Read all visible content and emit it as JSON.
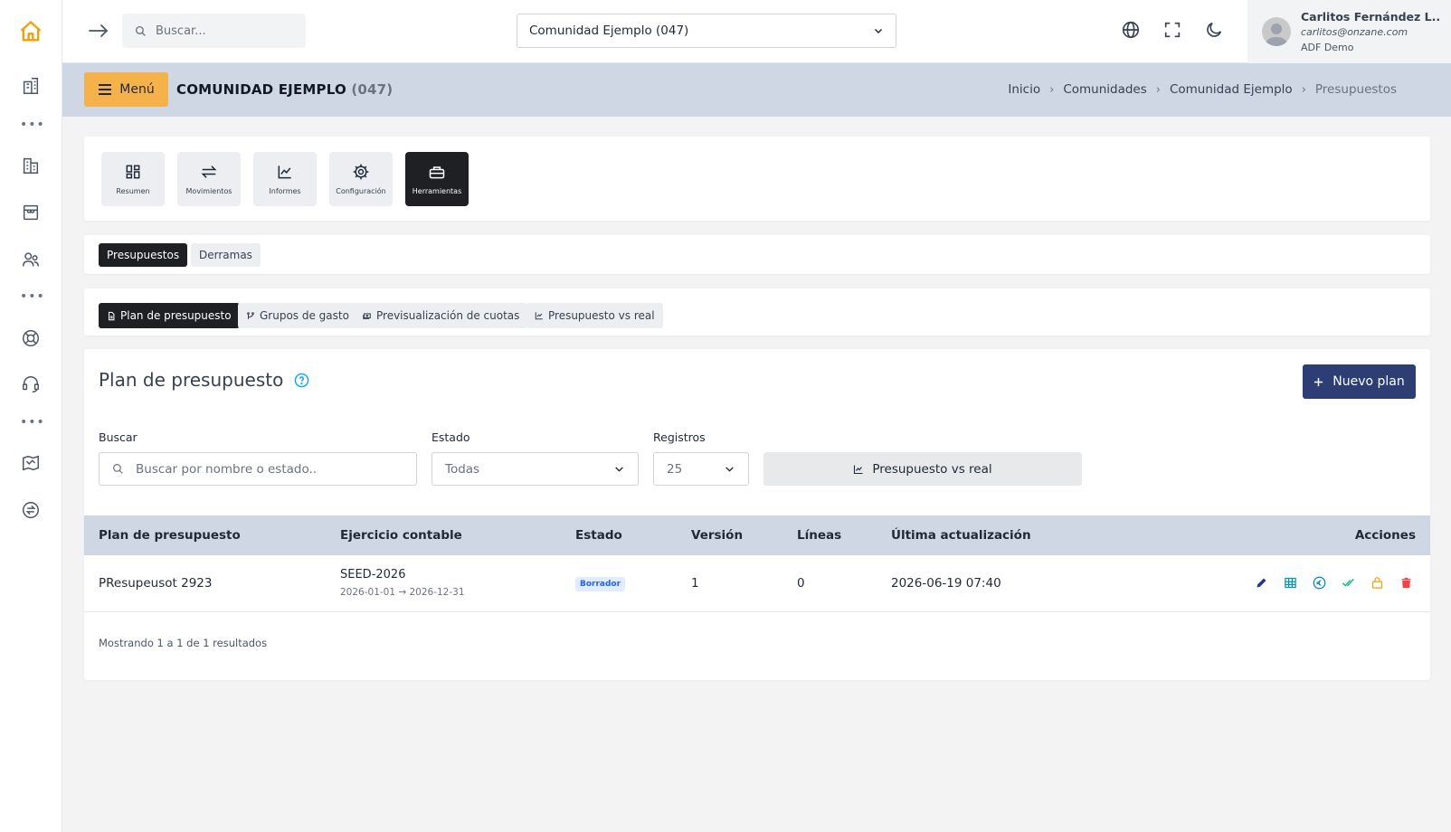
{
  "sidebar": {
    "icons": [
      "home-icon",
      "buildings-icon",
      "more-dots",
      "building-icon",
      "store-icon",
      "users-icon",
      "more-dots",
      "help-ring-icon",
      "support-headset-icon",
      "more-dots",
      "map-icon",
      "exchange-icon"
    ]
  },
  "topbar": {
    "search_placeholder": "Buscar...",
    "community_selected": "Comunidad Ejemplo (047)",
    "user": {
      "name": "Carlitos Fernández L..",
      "email": "carlitos@onzane.com",
      "org": "ADF Demo"
    }
  },
  "header": {
    "menu_label": "Menú",
    "title": "COMUNIDAD EJEMPLO",
    "code": "(047)",
    "breadcrumb": [
      "Inicio",
      "Comunidades",
      "Comunidad Ejemplo",
      "Presupuestos"
    ]
  },
  "tools": [
    {
      "label": "Resumen",
      "icon": "dashboard-icon",
      "active": false
    },
    {
      "label": "Movimientos",
      "icon": "transfer-icon",
      "active": false
    },
    {
      "label": "Informes",
      "icon": "chart-line-icon",
      "active": false
    },
    {
      "label": "Configuración",
      "icon": "gear-icon",
      "active": false
    },
    {
      "label": "Herramientas",
      "icon": "toolbox-icon",
      "active": true
    }
  ],
  "tabs": [
    {
      "label": "Presupuestos",
      "active": true
    },
    {
      "label": "Derramas",
      "active": false
    }
  ],
  "subtabs": [
    {
      "label": "Plan de presupuesto",
      "icon": "document-icon",
      "active": true
    },
    {
      "label": "Grupos de gasto",
      "icon": "branch-icon",
      "active": false
    },
    {
      "label": "Previsualización de cuotas",
      "icon": "cash-icon",
      "active": false
    },
    {
      "label": "Presupuesto vs real",
      "icon": "chart-line-icon",
      "active": false
    }
  ],
  "main": {
    "title": "Plan de presupuesto",
    "new_plan_label": "Nuevo plan",
    "filters": {
      "search_label": "Buscar",
      "search_placeholder": "Buscar por nombre o estado..",
      "status_label": "Estado",
      "status_value": "Todas",
      "records_label": "Registros",
      "records_value": "25",
      "compare_button": "Presupuesto vs real"
    },
    "table": {
      "columns": [
        "Plan de presupuesto",
        "Ejercicio contable",
        "Estado",
        "Versión",
        "Líneas",
        "Última actualización",
        "Acciones"
      ],
      "rows": [
        {
          "plan": "PResupeusot 2923",
          "exercise": "SEED-2026",
          "exercise_range": "2026-01-01 → 2026-12-31",
          "status": "Borrador",
          "version": "1",
          "lines": "0",
          "updated": "2026-06-19 07:40"
        }
      ]
    },
    "footer": "Mostrando 1 a 1 de 1 resultados"
  },
  "colors": {
    "accent": "#f6b24a",
    "primary": "#2c3e73",
    "header_band": "#cfd7e4",
    "dark": "#1f2024"
  }
}
